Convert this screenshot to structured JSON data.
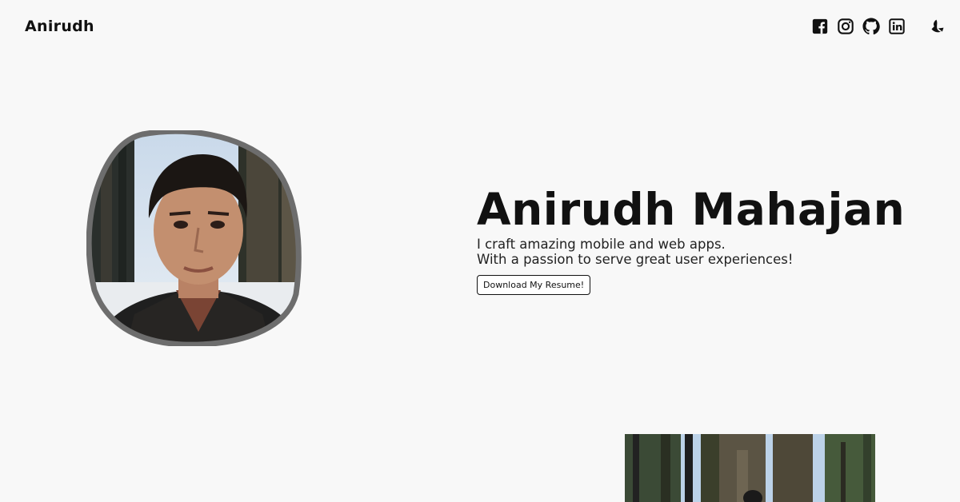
{
  "header": {
    "brand": "Anirudh",
    "socials": [
      {
        "icon": "facebook-icon"
      },
      {
        "icon": "instagram-icon"
      },
      {
        "icon": "github-icon"
      },
      {
        "icon": "linkedin-icon"
      }
    ],
    "theme_toggle_icon": "moon-icon"
  },
  "hero": {
    "name": "Anirudh Mahajan",
    "tagline_line1": "I craft amazing mobile and web apps.",
    "tagline_line2": "With a passion to serve great user experiences!",
    "resume_button": "Download My Resume!"
  },
  "colors": {
    "background": "#f8f8f8",
    "text": "#111111",
    "avatar_border": "#6d6d6d"
  }
}
